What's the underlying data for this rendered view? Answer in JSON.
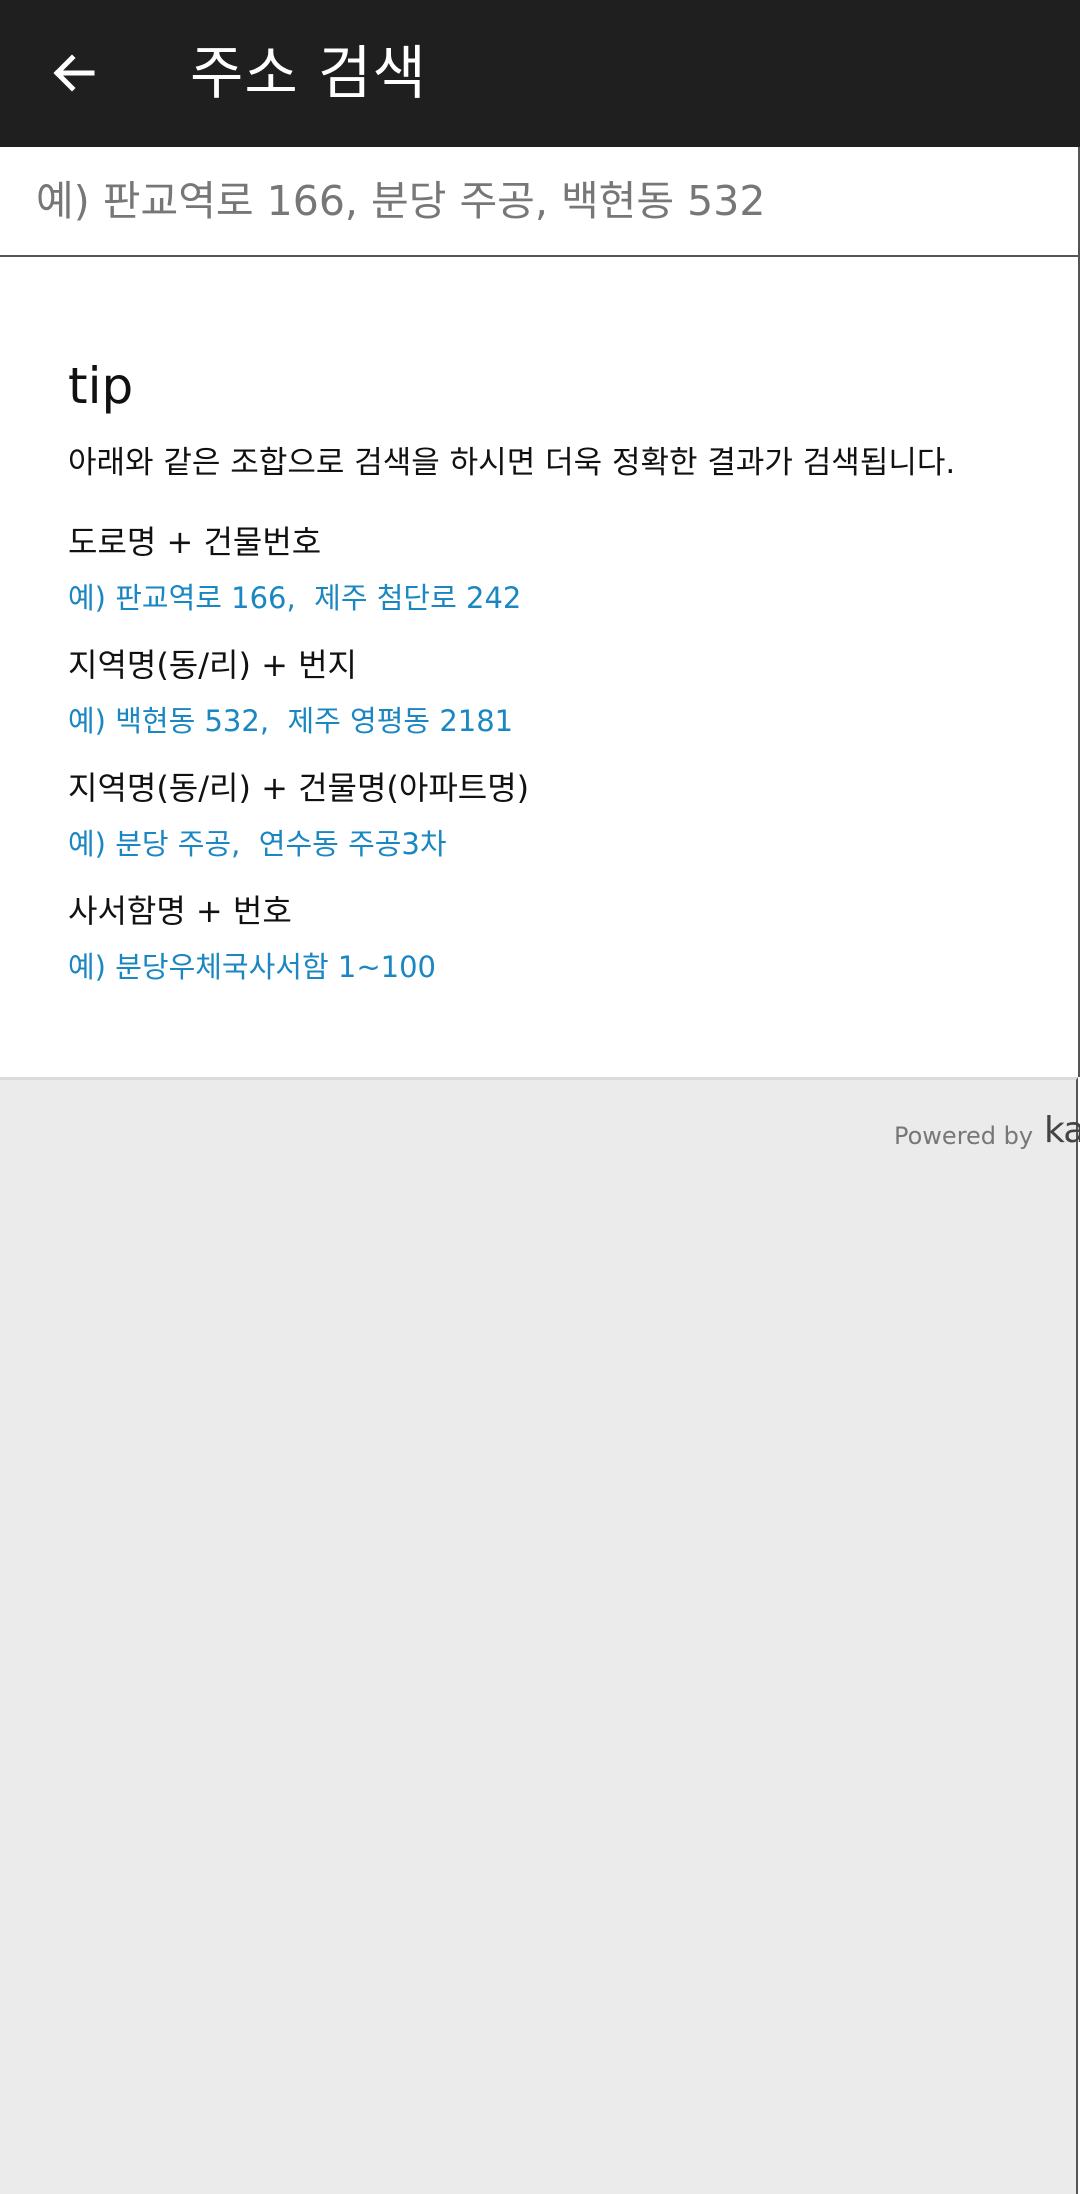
{
  "app_bar": {
    "title": "주소 검색",
    "back_icon": "arrow-left-icon"
  },
  "search": {
    "value": "",
    "placeholder": "예) 판교역로 166, 분당 주공, 백현동 532"
  },
  "tip": {
    "title": "tip",
    "description": "아래와 같은 조합으로 검색을 하시면 더욱 정확한 결과가 검색됩니다.",
    "items": [
      {
        "label": "도로명 + 건물번호",
        "example": "예) 판교역로 166,  제주 첨단로 242"
      },
      {
        "label": "지역명(동/리) + 번지",
        "example": "예) 백현동 532,  제주 영평동 2181"
      },
      {
        "label": "지역명(동/리) + 건물명(아파트명)",
        "example": "예) 분당 주공,  연수동 주공3차"
      },
      {
        "label": "사서함명 + 번호",
        "example": "예) 분당우체국사서함 1~100"
      }
    ]
  },
  "footer": {
    "powered_by": "Powered by",
    "brand": "ka"
  },
  "colors": {
    "app_bar": "#1f1f1f",
    "example_text": "#1a87c2",
    "footer_bg": "#ebebeb"
  }
}
